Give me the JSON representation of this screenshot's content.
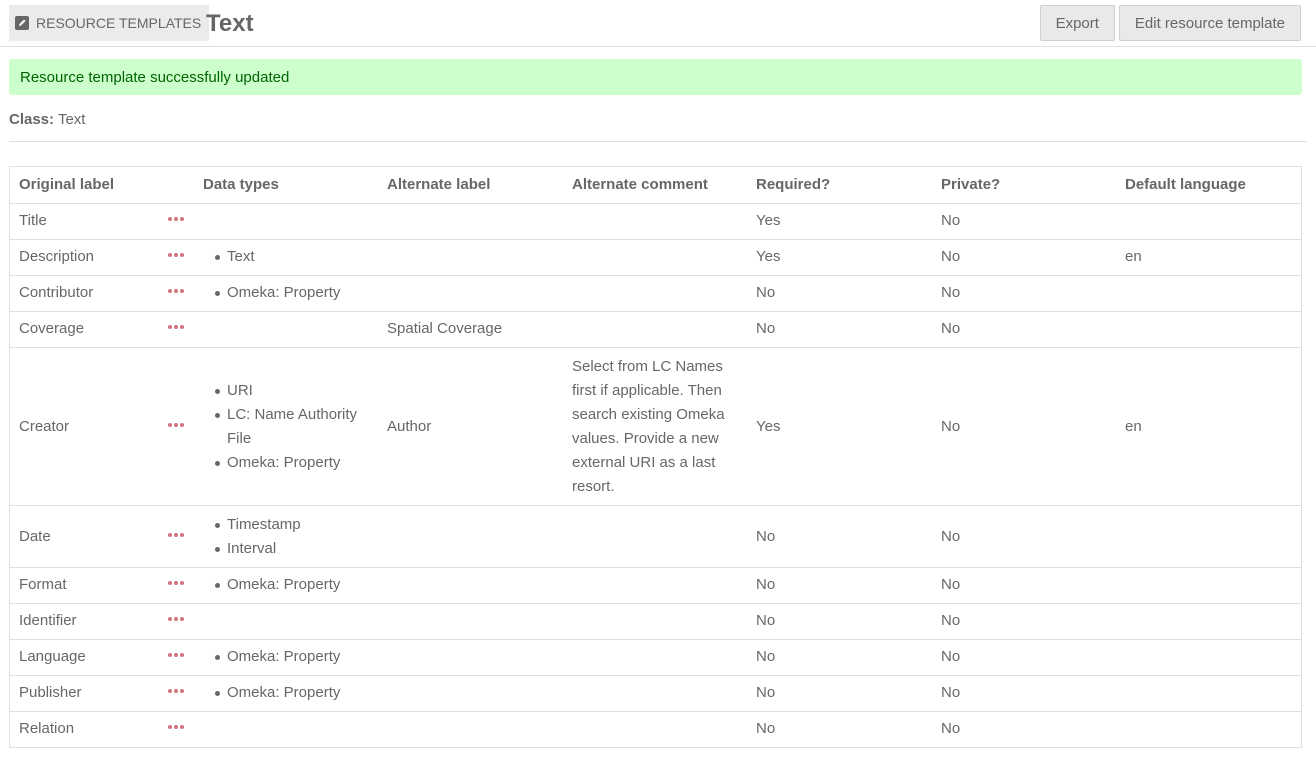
{
  "header": {
    "breadcrumb_label": "Resource Templates",
    "breadcrumb_icon": "edit-icon",
    "title": "Text",
    "export_label": "Export",
    "edit_label": "Edit resource template"
  },
  "message": {
    "text": "Resource template successfully updated",
    "bg_color": "#cdffcd",
    "text_color": "#006400"
  },
  "class_info": {
    "label": "Class:",
    "value": "Text"
  },
  "table": {
    "columns": [
      "Original label",
      "Data types",
      "Alternate label",
      "Alternate comment",
      "Required?",
      "Private?",
      "Default language"
    ],
    "rows": [
      {
        "label": "Title",
        "data_types": [],
        "alt_label": "",
        "alt_comment": "",
        "required": "Yes",
        "private": "No",
        "lang": ""
      },
      {
        "label": "Description",
        "data_types": [
          "Text"
        ],
        "alt_label": "",
        "alt_comment": "",
        "required": "Yes",
        "private": "No",
        "lang": "en"
      },
      {
        "label": "Contributor",
        "data_types": [
          "Omeka: Property"
        ],
        "alt_label": "",
        "alt_comment": "",
        "required": "No",
        "private": "No",
        "lang": ""
      },
      {
        "label": "Coverage",
        "data_types": [],
        "alt_label": "Spatial Coverage",
        "alt_comment": "",
        "required": "No",
        "private": "No",
        "lang": ""
      },
      {
        "label": "Creator",
        "data_types": [
          "URI",
          "LC: Name Authority File",
          "Omeka: Property"
        ],
        "alt_label": "Author",
        "alt_comment": "Select from LC Names first if applicable. Then search existing Omeka values. Provide a new external URI as a last resort.",
        "required": "Yes",
        "private": "No",
        "lang": "en"
      },
      {
        "label": "Date",
        "data_types": [
          "Timestamp",
          "Interval"
        ],
        "alt_label": "",
        "alt_comment": "",
        "required": "No",
        "private": "No",
        "lang": ""
      },
      {
        "label": "Format",
        "data_types": [
          "Omeka: Property"
        ],
        "alt_label": "",
        "alt_comment": "",
        "required": "No",
        "private": "No",
        "lang": ""
      },
      {
        "label": "Identifier",
        "data_types": [],
        "alt_label": "",
        "alt_comment": "",
        "required": "No",
        "private": "No",
        "lang": ""
      },
      {
        "label": "Language",
        "data_types": [
          "Omeka: Property"
        ],
        "alt_label": "",
        "alt_comment": "",
        "required": "No",
        "private": "No",
        "lang": ""
      },
      {
        "label": "Publisher",
        "data_types": [
          "Omeka: Property"
        ],
        "alt_label": "",
        "alt_comment": "",
        "required": "No",
        "private": "No",
        "lang": ""
      },
      {
        "label": "Relation",
        "data_types": [],
        "alt_label": "",
        "alt_comment": "",
        "required": "No",
        "private": "No",
        "lang": ""
      }
    ]
  }
}
